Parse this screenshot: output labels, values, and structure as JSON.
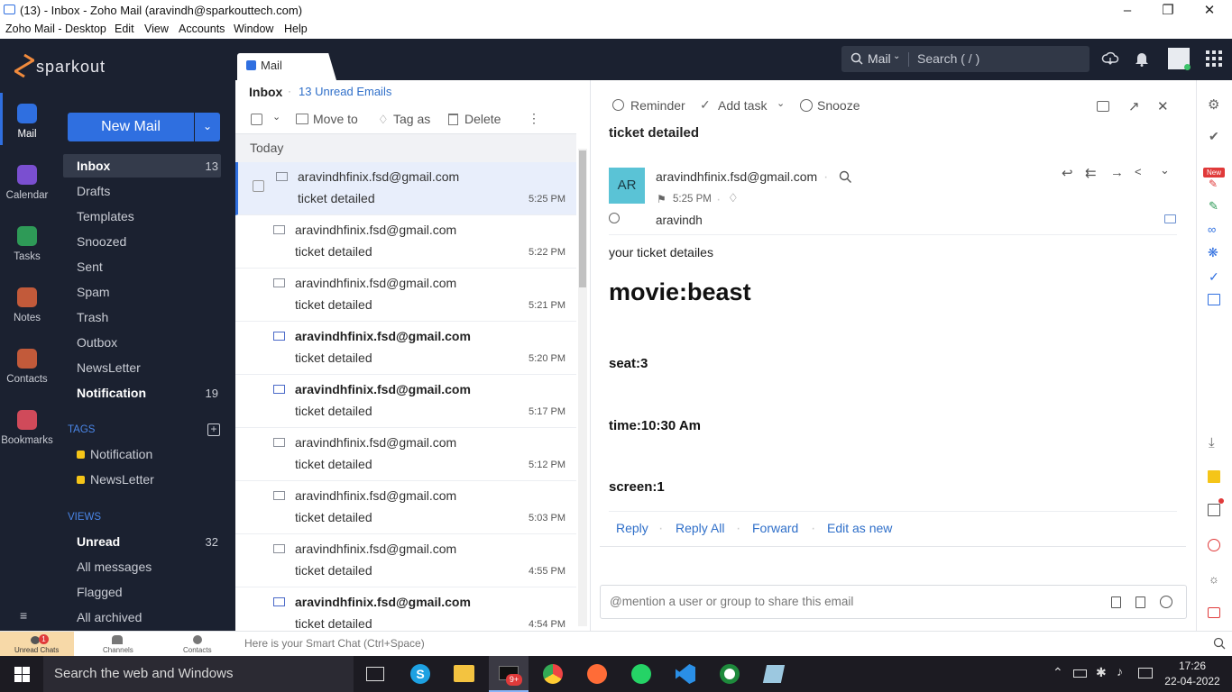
{
  "window": {
    "title": "(13) - Inbox - Zoho Mail (aravindh@sparkouttech.com)"
  },
  "menu": [
    "Zoho Mail - Desktop",
    "Edit",
    "View",
    "Accounts",
    "Window",
    "Help"
  ],
  "brand": {
    "name": "sparkout"
  },
  "header": {
    "search_scope": "Mail",
    "search_placeholder": "Search ( / )"
  },
  "rail": [
    {
      "label": "Mail",
      "color": "#2f6fe0"
    },
    {
      "label": "Calendar",
      "color": "#7a4fd0"
    },
    {
      "label": "Tasks",
      "color": "#2e9a57"
    },
    {
      "label": "Notes",
      "color": "#c25a3a"
    },
    {
      "label": "Contacts",
      "color": "#c25a3a"
    },
    {
      "label": "Bookmarks",
      "color": "#d04a5a"
    }
  ],
  "sidebar": {
    "new_mail": "New Mail",
    "folders": [
      {
        "label": "Inbox",
        "count": "13"
      },
      {
        "label": "Drafts",
        "count": ""
      },
      {
        "label": "Templates",
        "count": ""
      },
      {
        "label": "Snoozed",
        "count": ""
      },
      {
        "label": "Sent",
        "count": ""
      },
      {
        "label": "Spam",
        "count": ""
      },
      {
        "label": "Trash",
        "count": ""
      },
      {
        "label": "Outbox",
        "count": ""
      },
      {
        "label": "NewsLetter",
        "count": ""
      },
      {
        "label": "Notification",
        "count": "19"
      }
    ],
    "tags_heading": "TAGS",
    "tags": [
      "Notification",
      "NewsLetter"
    ],
    "views_heading": "VIEWS",
    "views": [
      {
        "label": "Unread",
        "count": "32"
      },
      {
        "label": "All messages",
        "count": ""
      },
      {
        "label": "Flagged",
        "count": ""
      },
      {
        "label": "All archived",
        "count": ""
      }
    ]
  },
  "list": {
    "tab": "Mail",
    "breadcrumb": "Inbox",
    "unread": "13 Unread Emails",
    "toolbar": {
      "move": "Move to",
      "tag": "Tag as",
      "delete": "Delete"
    },
    "group": "Today",
    "emails": [
      {
        "from": "aravindhfinix.fsd@gmail.com",
        "subject": "ticket detailed",
        "time": "5:25 PM",
        "unread": false
      },
      {
        "from": "aravindhfinix.fsd@gmail.com",
        "subject": "ticket detailed",
        "time": "5:22 PM",
        "unread": false
      },
      {
        "from": "aravindhfinix.fsd@gmail.com",
        "subject": "ticket detailed",
        "time": "5:21 PM",
        "unread": false
      },
      {
        "from": "aravindhfinix.fsd@gmail.com",
        "subject": "ticket detailed",
        "time": "5:20 PM",
        "unread": true
      },
      {
        "from": "aravindhfinix.fsd@gmail.com",
        "subject": "ticket detailed",
        "time": "5:17 PM",
        "unread": true
      },
      {
        "from": "aravindhfinix.fsd@gmail.com",
        "subject": "ticket detailed",
        "time": "5:12 PM",
        "unread": false
      },
      {
        "from": "aravindhfinix.fsd@gmail.com",
        "subject": "ticket detailed",
        "time": "5:03 PM",
        "unread": false
      },
      {
        "from": "aravindhfinix.fsd@gmail.com",
        "subject": "ticket detailed",
        "time": "4:55 PM",
        "unread": false
      },
      {
        "from": "aravindhfinix.fsd@gmail.com",
        "subject": "ticket detailed",
        "time": "4:54 PM",
        "unread": true
      }
    ]
  },
  "reading": {
    "toolbar": {
      "reminder": "Reminder",
      "add_task": "Add task",
      "snooze": "Snooze"
    },
    "subject": "ticket detailed",
    "avatar": "AR",
    "from": "aravindhfinix.fsd@gmail.com",
    "time": "5:25 PM",
    "to": "aravindh",
    "body": {
      "intro": "your ticket detailes",
      "heading": "movie:beast",
      "lines": [
        "seat:3",
        "time:10:30 Am",
        "screen:1"
      ]
    },
    "actions": [
      "Reply",
      "Reply All",
      "Forward",
      "Edit as new"
    ],
    "comment_placeholder": "@mention a user or group to share this email"
  },
  "bottom": {
    "tabs": [
      "Unread Chats",
      "Channels",
      "Contacts"
    ],
    "unread_badge": "1",
    "smartchat": "Here is your Smart Chat (Ctrl+Space)"
  },
  "taskbar": {
    "search": "Search the web and Windows",
    "time": "17:26",
    "date": "22-04-2022",
    "badge": "9+"
  },
  "colors": {
    "dark": "#1b2130",
    "accent": "#2f6fe0",
    "link": "#2f6fc9",
    "tag_yellow": "#f5c518"
  }
}
